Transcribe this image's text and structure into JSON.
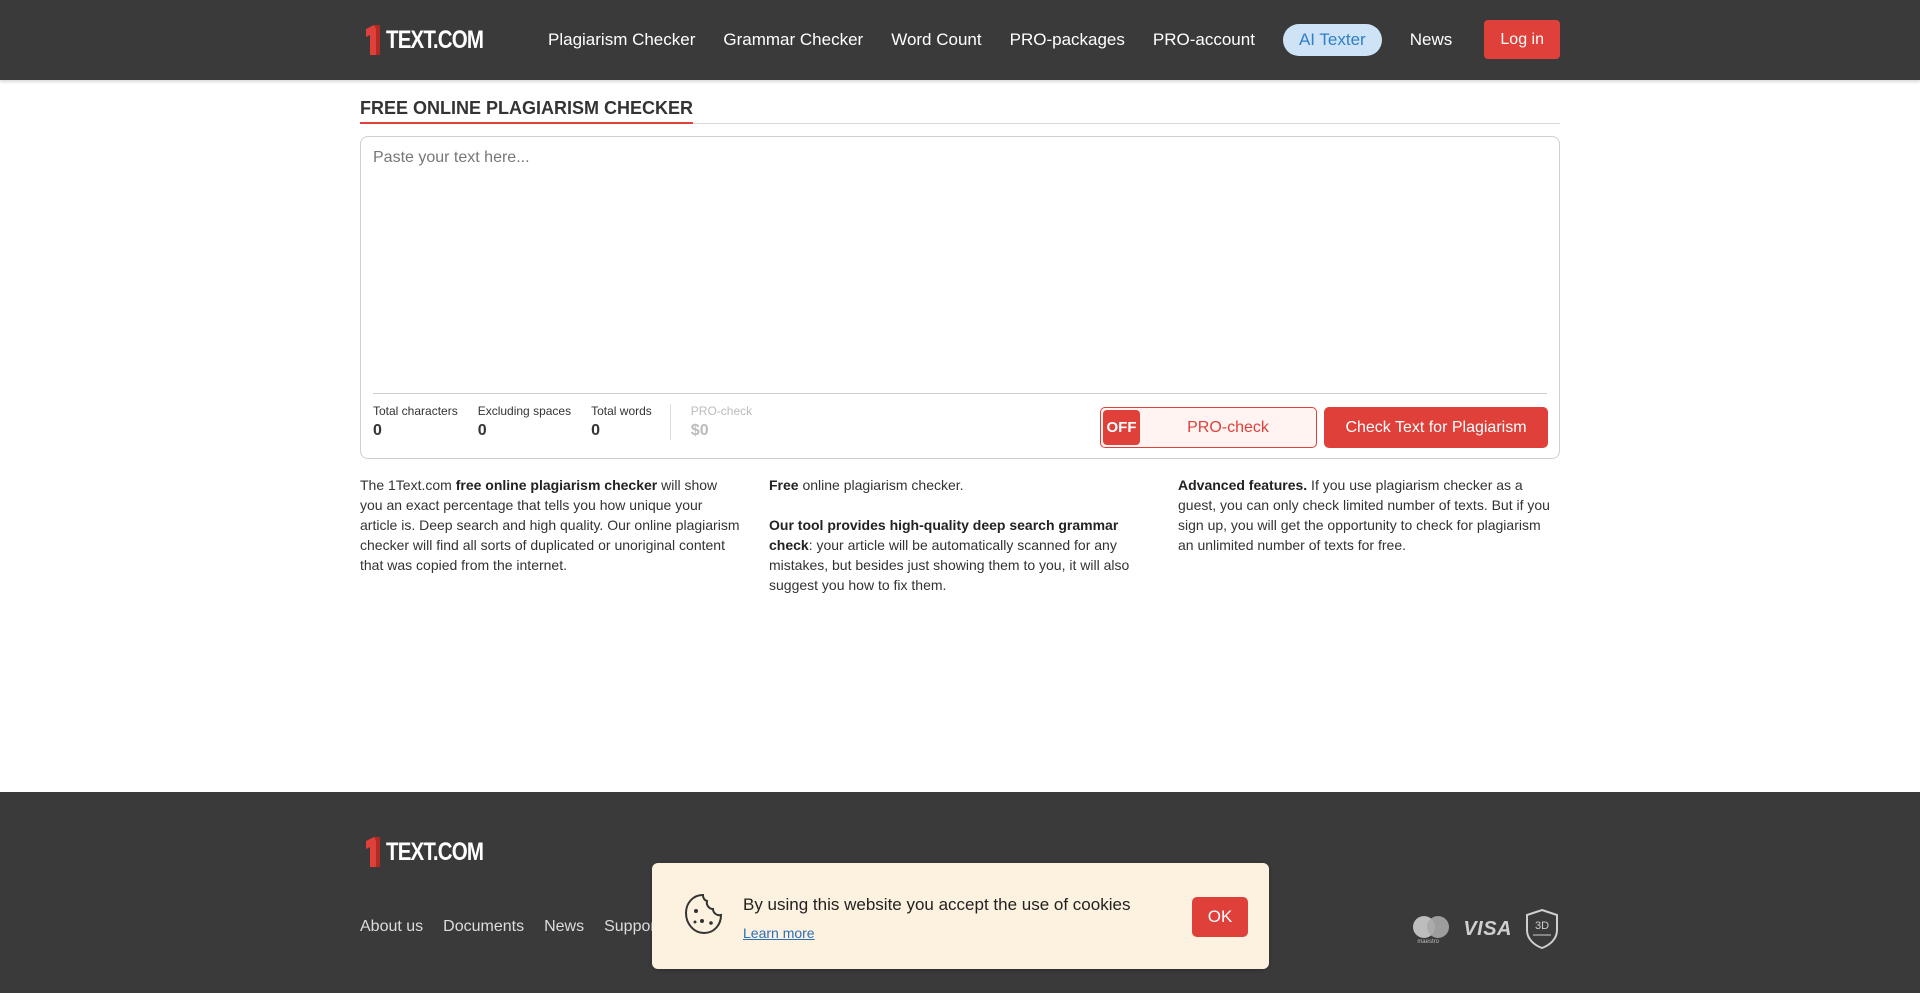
{
  "brand": {
    "logo_text": "TEXT.COM",
    "accent": "#e0403a",
    "header_bg": "#3a3a3a"
  },
  "nav": {
    "items": [
      {
        "label": "Plagiarism Checker"
      },
      {
        "label": "Grammar Checker"
      },
      {
        "label": "Word Count"
      },
      {
        "label": "PRO-packages"
      },
      {
        "label": "PRO-account"
      },
      {
        "label": "AI Texter"
      },
      {
        "label": "News"
      }
    ],
    "login_label": "Log in"
  },
  "main": {
    "title": "FREE ONLINE PLAGIARISM CHECKER",
    "editor_placeholder": "Paste your text here...",
    "stats": [
      {
        "label": "Total characters",
        "value": "0"
      },
      {
        "label": "Excluding spaces",
        "value": "0"
      },
      {
        "label": "Total words",
        "value": "0"
      }
    ],
    "pro_stat": {
      "label": "PRO-check",
      "value": "$0"
    },
    "pro_toggle": {
      "state": "OFF",
      "label": "PRO-check"
    },
    "check_button": "Check Text for Plagiarism"
  },
  "info": {
    "col1": {
      "t1": "The 1Text.com ",
      "b1": "free online plagiarism checker",
      "t2": " will show you an exact percentage that tells you how unique your article is. Deep search and high quality. Our online plagiarism checker will find all sorts of duplicated or unoriginal content that was copied from the internet."
    },
    "col2": {
      "b1": "Free",
      "t1": " online plagiarism checker.",
      "b2": "Our tool provides high-quality deep search grammar check",
      "t2": ": your article will be automatically scanned for any mistakes, but besides just showing them to you, it will also suggest you how to fix them."
    },
    "col3": {
      "b1": "Advanced features.",
      "t1": " If you use plagiarism checker as a guest, you can only check limited number of texts. But if you sign up, you will get the opportunity to check for plagiarism an unlimited number of texts for free."
    }
  },
  "footer": {
    "links": [
      {
        "label": "About us"
      },
      {
        "label": "Documents"
      },
      {
        "label": "News"
      },
      {
        "label": "Support"
      }
    ],
    "payments": {
      "mastercard_label": "maestro",
      "visa_label": "VISA",
      "secure_label": "3D"
    }
  },
  "cookie": {
    "text": "By using this website you accept the use of cookies",
    "link": "Learn more",
    "ok": "OK"
  }
}
